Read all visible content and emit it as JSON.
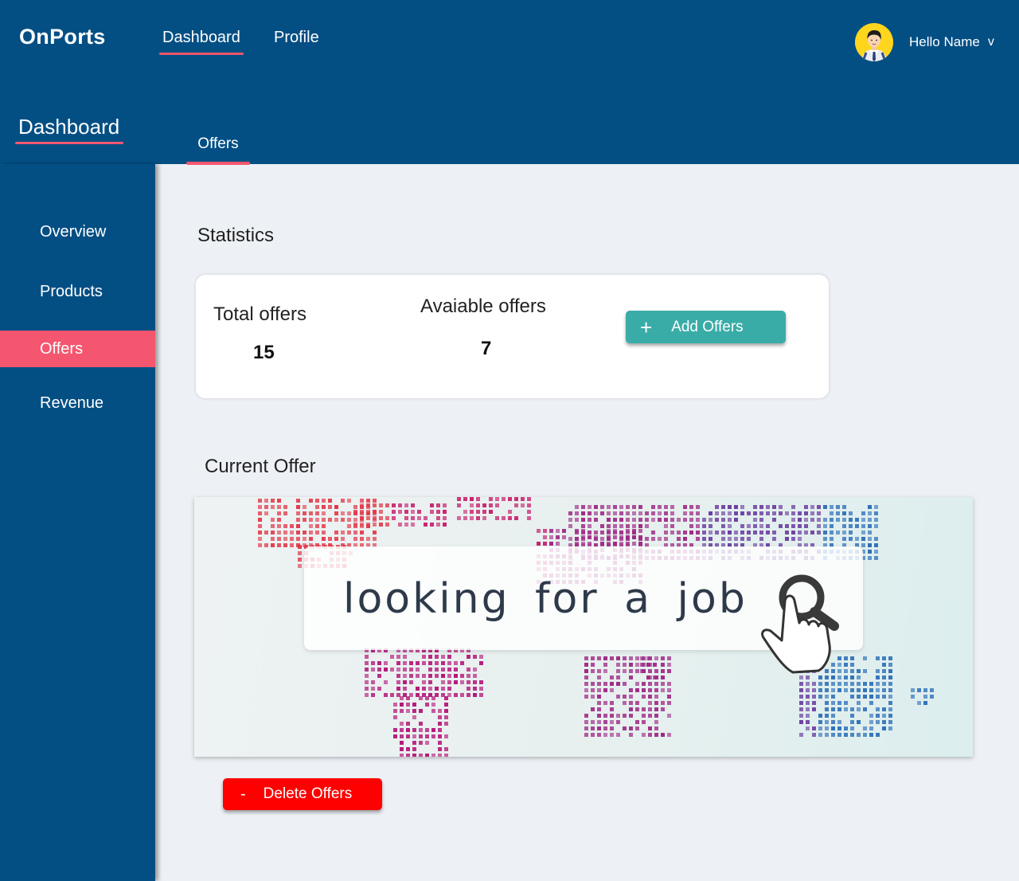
{
  "app": {
    "brand": "OnPorts"
  },
  "topnav": {
    "items": [
      {
        "label": "Dashboard",
        "active": true
      },
      {
        "label": "Profile",
        "active": false
      }
    ]
  },
  "user": {
    "greeting": "Hello Name",
    "chevron": "v",
    "avatar_icon": "user-avatar-icon"
  },
  "sidebar": {
    "title": "Dashboard",
    "items": [
      {
        "label": "Overview",
        "active": false
      },
      {
        "label": "Products",
        "active": false
      },
      {
        "label": "Offers",
        "active": true
      },
      {
        "label": "Revenue",
        "active": false
      }
    ]
  },
  "subtabs": [
    {
      "label": "Offers",
      "active": true
    }
  ],
  "statistics": {
    "title": "Statistics",
    "total_label": "Total offers",
    "total_value": "15",
    "available_label": "Avaiable offers",
    "available_value": "7",
    "add_button": {
      "icon": "+",
      "label": "Add Offers"
    }
  },
  "current_offer": {
    "title": "Current Offer",
    "banner_text": "looking for a job",
    "delete_button": {
      "icon": "-",
      "label": "Delete Offers"
    }
  },
  "colors": {
    "primary": "#034f84",
    "accent": "#f4566f",
    "add_button": "#3aaca7",
    "delete_button": "#ff0000",
    "background": "#edf1f5"
  }
}
